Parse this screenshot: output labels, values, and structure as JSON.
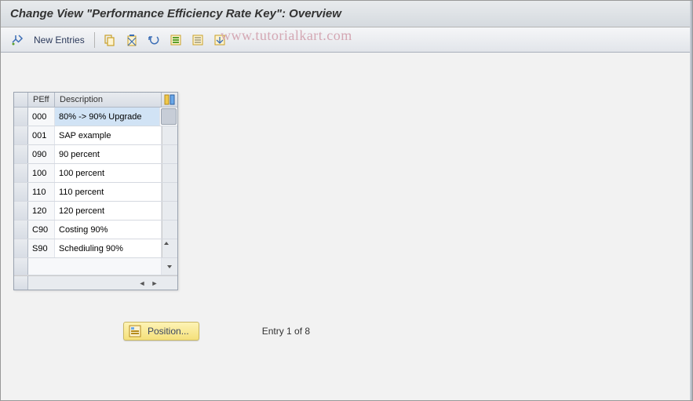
{
  "title": "Change View \"Performance Efficiency Rate Key\": Overview",
  "toolbar": {
    "new_entries_label": "New Entries"
  },
  "watermark": "www.tutorialkart.com",
  "table": {
    "headers": {
      "peff": "PEff",
      "description": "Description"
    },
    "rows": [
      {
        "peff": "000",
        "desc": "80% -> 90% Upgrade",
        "selected": true
      },
      {
        "peff": "001",
        "desc": "SAP example",
        "selected": false
      },
      {
        "peff": "090",
        "desc": "90 percent",
        "selected": false
      },
      {
        "peff": "100",
        "desc": "100 percent",
        "selected": false
      },
      {
        "peff": "110",
        "desc": "110 percent",
        "selected": false
      },
      {
        "peff": "120",
        "desc": "120 percent",
        "selected": false
      },
      {
        "peff": "C90",
        "desc": "Costing 90%",
        "selected": false
      },
      {
        "peff": "S90",
        "desc": "Schediuling 90%",
        "selected": false
      }
    ]
  },
  "footer": {
    "position_label": "Position...",
    "entry_text": "Entry 1 of 8"
  }
}
